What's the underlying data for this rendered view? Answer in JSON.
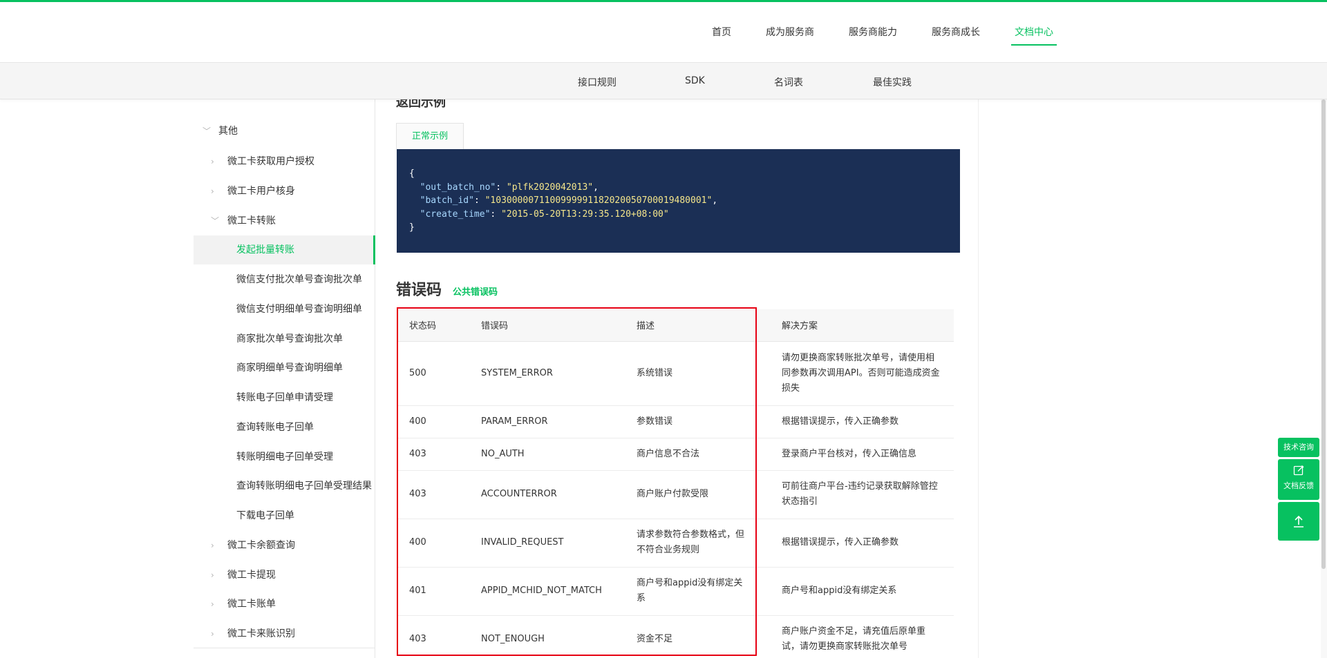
{
  "header": {
    "nav": [
      {
        "label": "首页",
        "active": false
      },
      {
        "label": "成为服务商",
        "active": false
      },
      {
        "label": "服务商能力",
        "active": false
      },
      {
        "label": "服务商成长",
        "active": false
      },
      {
        "label": "文档中心",
        "active": true
      }
    ]
  },
  "subheader": {
    "items": [
      "接口规则",
      "SDK",
      "名词表",
      "最佳实践"
    ]
  },
  "sidebar": {
    "items": [
      {
        "label": "其他",
        "arrow": "﹀",
        "level": 0
      },
      {
        "label": "微工卡获取用户授权",
        "arrow": "›",
        "level": 1
      },
      {
        "label": "微工卡用户核身",
        "arrow": "›",
        "level": 1
      },
      {
        "label": "微工卡转账",
        "arrow": "﹀",
        "level": 1
      },
      {
        "label": "发起批量转账",
        "arrow": "",
        "level": 2,
        "active": true
      },
      {
        "label": "微信支付批次单号查询批次单",
        "arrow": "",
        "level": 2
      },
      {
        "label": "微信支付明细单号查询明细单",
        "arrow": "",
        "level": 2
      },
      {
        "label": "商家批次单号查询批次单",
        "arrow": "",
        "level": 2
      },
      {
        "label": "商家明细单号查询明细单",
        "arrow": "",
        "level": 2
      },
      {
        "label": "转账电子回单申请受理",
        "arrow": "",
        "level": 2
      },
      {
        "label": "查询转账电子回单",
        "arrow": "",
        "level": 2
      },
      {
        "label": "转账明细电子回单受理",
        "arrow": "",
        "level": 2
      },
      {
        "label": "查询转账明细电子回单受理结果",
        "arrow": "",
        "level": 2
      },
      {
        "label": "下载电子回单",
        "arrow": "",
        "level": 2
      },
      {
        "label": "微工卡余额查询",
        "arrow": "›",
        "level": 1
      },
      {
        "label": "微工卡提现",
        "arrow": "›",
        "level": 1
      },
      {
        "label": "微工卡账单",
        "arrow": "›",
        "level": 1
      },
      {
        "label": "微工卡来账识别",
        "arrow": "›",
        "level": 1
      }
    ]
  },
  "doc": {
    "section_title": "返回示例",
    "example_tab": "正常示例",
    "code": {
      "open": "{",
      "lines": [
        {
          "key": "\"out_batch_no\"",
          "sep": ": ",
          "val": "\"plfk2020042013\"",
          "end": ","
        },
        {
          "key": "\"batch_id\"",
          "sep": ": ",
          "val": "\"1030000071100999991182020050700019480001\"",
          "end": ","
        },
        {
          "key": "\"create_time\"",
          "sep": ": ",
          "val": "\"2015-05-20T13:29:35.120+08:00\"",
          "end": ""
        }
      ],
      "close": "}"
    },
    "error_title": "错误码",
    "error_link": "公共错误码",
    "table": {
      "headers": [
        "状态码",
        "错误码",
        "描述",
        "解决方案"
      ],
      "rows": [
        {
          "status": "500",
          "code": "SYSTEM_ERROR",
          "desc": "系统错误",
          "solution": "请勿更换商家转账批次单号，请使用相同参数再次调用API。否则可能造成资金损失"
        },
        {
          "status": "400",
          "code": "PARAM_ERROR",
          "desc": "参数错误",
          "solution": "根据错误提示，传入正确参数"
        },
        {
          "status": "403",
          "code": "NO_AUTH",
          "desc": "商户信息不合法",
          "solution": "登录商户平台核对，传入正确信息"
        },
        {
          "status": "403",
          "code": "ACCOUNTERROR",
          "desc": "商户账户付款受限",
          "solution": "可前往商户平台-违约记录获取解除管控状态指引"
        },
        {
          "status": "400",
          "code": "INVALID_REQUEST",
          "desc": "请求参数符合参数格式，但不符合业务规则",
          "solution": "根据错误提示，传入正确参数"
        },
        {
          "status": "401",
          "code": "APPID_MCHID_NOT_MATCH",
          "desc": "商户号和appid没有绑定关系",
          "solution": "商户号和appid没有绑定关系"
        },
        {
          "status": "403",
          "code": "NOT_ENOUGH",
          "desc": "资金不足",
          "solution": "商户账户资金不足，请充值后原单重试，请勿更换商家转账批次单号"
        }
      ]
    }
  },
  "float_tools": {
    "consult": "技术咨询",
    "feedback": "文档反馈",
    "feedback_icon": "edit-icon",
    "top_icon": "arrow-up-icon"
  },
  "colors": {
    "accent": "#07c160",
    "code_bg": "#1b2f55",
    "highlight_box": "#e60012"
  }
}
